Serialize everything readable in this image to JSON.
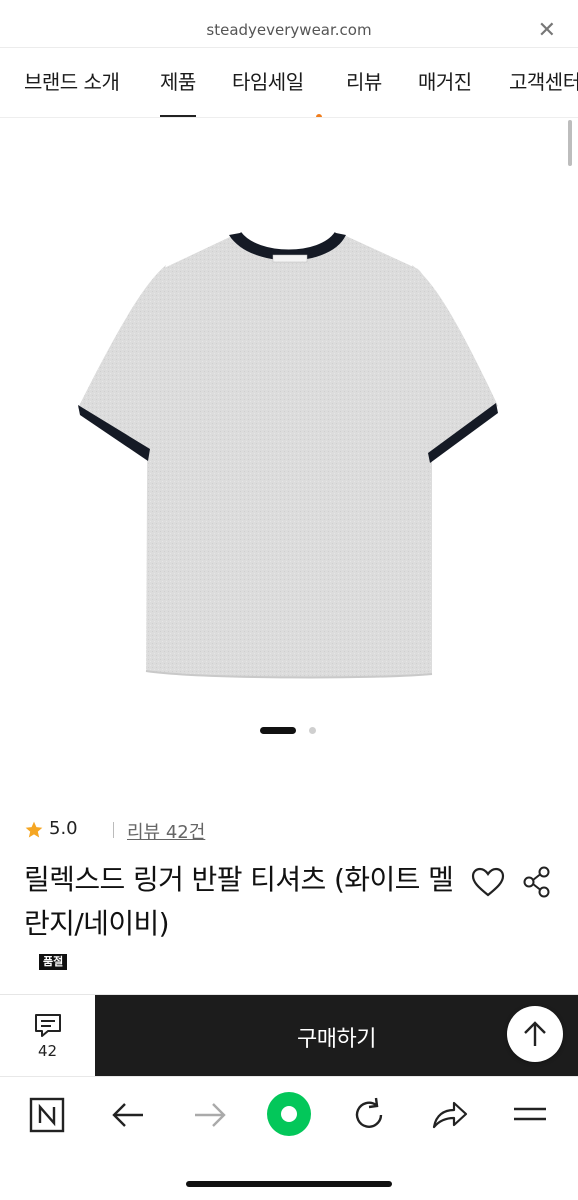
{
  "browser": {
    "url": "steadyeverywear.com",
    "close_icon": "close-icon"
  },
  "tabs": [
    {
      "label": "브랜드 소개",
      "active": false,
      "new_dot": false
    },
    {
      "label": "제품",
      "active": true,
      "new_dot": false
    },
    {
      "label": "타임세일",
      "active": false,
      "new_dot": true
    },
    {
      "label": "리뷰",
      "active": false,
      "new_dot": false
    },
    {
      "label": "매거진",
      "active": false,
      "new_dot": false
    },
    {
      "label": "고객센터",
      "active": false,
      "new_dot": false
    }
  ],
  "gallery": {
    "current_index": 1,
    "total": 2
  },
  "product": {
    "rating": "5.0",
    "review_link": "리뷰 42건",
    "title": "릴렉스드 링거 반팔 티셔츠 (화이트 멜란지/네이비)",
    "badge": "품절"
  },
  "buybar": {
    "qa_count": "42",
    "buy_label": "구매하기"
  },
  "colors": {
    "accent_dot": "#f07d1c",
    "buy_bg": "#1c1c1c",
    "star": "#f5a623",
    "nav_green": "#03c75a"
  }
}
